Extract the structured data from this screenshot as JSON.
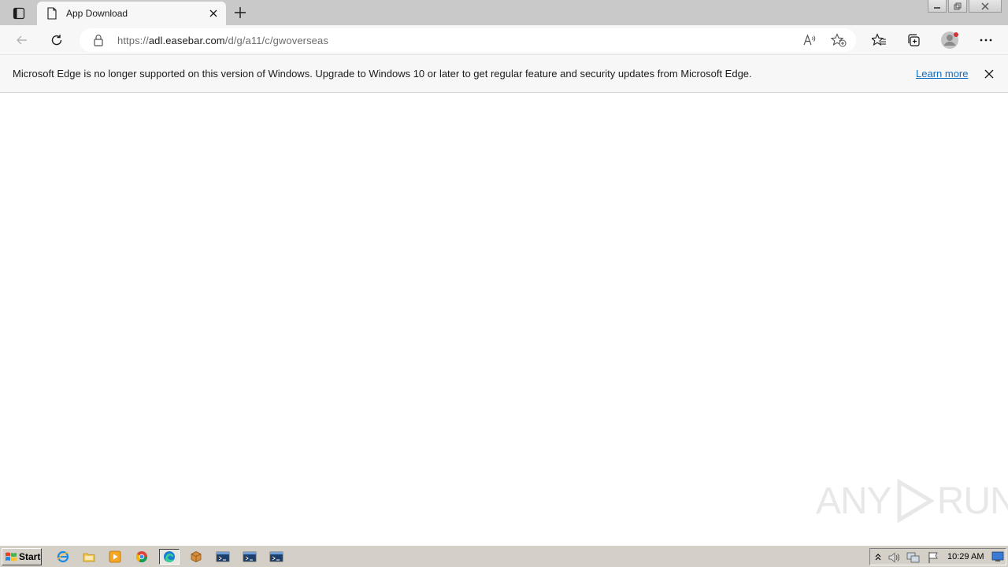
{
  "tab": {
    "title": "App Download"
  },
  "addressbar": {
    "url_prefix": "https://",
    "url_host": "adl.easebar.com",
    "url_path": "/d/g/a11/c/gwoverseas"
  },
  "infobar": {
    "message": "Microsoft Edge is no longer supported on this version of Windows. Upgrade to Windows 10 or later to get regular feature and security updates from Microsoft Edge.",
    "link_label": "Learn more"
  },
  "watermark": {
    "text_left": "ANY",
    "text_right": "RUN"
  },
  "taskbar": {
    "start_label": "Start",
    "clock": "10:29 AM"
  },
  "colors": {
    "link": "#0f6cbd",
    "tabstrip": "#c9c9c9",
    "toolbar": "#f7f7f7",
    "taskbar": "#d4d0c8"
  },
  "icons": {
    "tab_actions": "tab-actions-icon",
    "page": "page-icon",
    "close": "close-icon",
    "new_tab": "plus-icon",
    "back": "back-arrow-icon",
    "refresh": "refresh-icon",
    "lock": "lock-icon",
    "read_aloud": "read-aloud-icon",
    "add_favorite": "star-plus-icon",
    "favorites": "favorites-icon",
    "collections": "collections-icon",
    "profile": "profile-icon",
    "menu": "more-icon"
  }
}
